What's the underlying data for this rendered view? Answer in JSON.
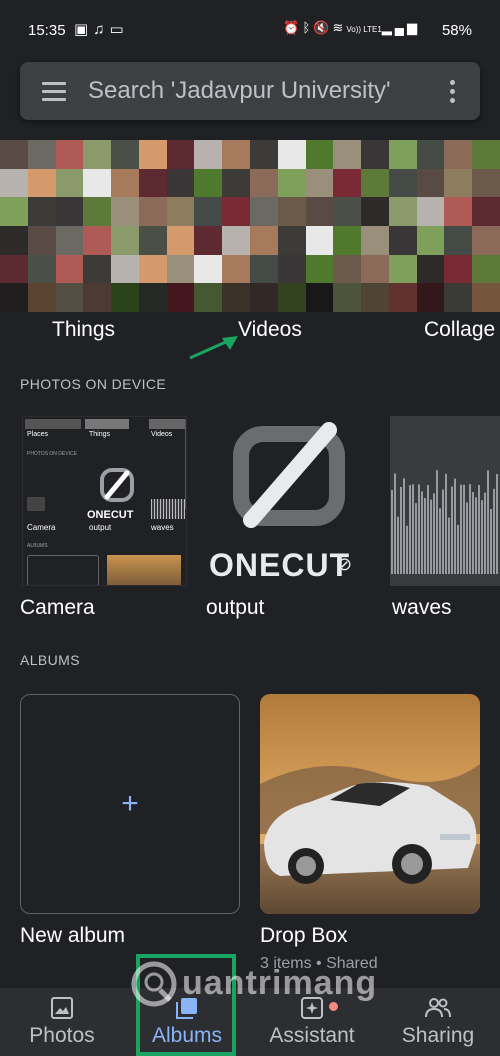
{
  "status_bar": {
    "time": "15:35",
    "left_icons": [
      "image-icon",
      "music-note-icon",
      "message-icon"
    ],
    "right_icons": [
      "alarm-icon",
      "bluetooth-icon",
      "mute-icon",
      "wifi-icon",
      "volte-icon",
      "signal-icon"
    ],
    "volte_text": "Vo)) LTE1",
    "battery": "58%"
  },
  "search": {
    "placeholder": "Search 'Jadavpur University'"
  },
  "categories": [
    {
      "label": "Things"
    },
    {
      "label": "Videos"
    },
    {
      "label": "Collage"
    }
  ],
  "photos_on_device": {
    "heading": "PHOTOS ON DEVICE",
    "items": [
      {
        "label": "Camera"
      },
      {
        "label": "output"
      },
      {
        "label": "waves"
      }
    ],
    "camera_preview": {
      "places": "Places",
      "things": "Things",
      "videos": "Videos",
      "section": "PHOTOS ON DEVICE",
      "camera": "Camera",
      "output": "output",
      "waves": "waves",
      "albums": "ALBUMS"
    },
    "output_logo_text": "ONECUT"
  },
  "albums": {
    "heading": "ALBUMS",
    "new_album": {
      "label": "New album",
      "icon": "plus-icon"
    },
    "drop_box": {
      "label": "Drop Box",
      "meta": "3 items  •  Shared"
    }
  },
  "bottom_nav": [
    {
      "label": "Photos",
      "icon": "photo-icon",
      "active": false
    },
    {
      "label": "Albums",
      "icon": "albums-icon",
      "active": true
    },
    {
      "label": "Assistant",
      "icon": "assistant-icon",
      "active": false
    },
    {
      "label": "Sharing",
      "icon": "people-icon",
      "active": false
    }
  ],
  "watermark": {
    "text": "uantrimang"
  },
  "colors": {
    "background": "#202124",
    "accent": "#8ab4f8",
    "annotation_green": "#1aa462"
  }
}
